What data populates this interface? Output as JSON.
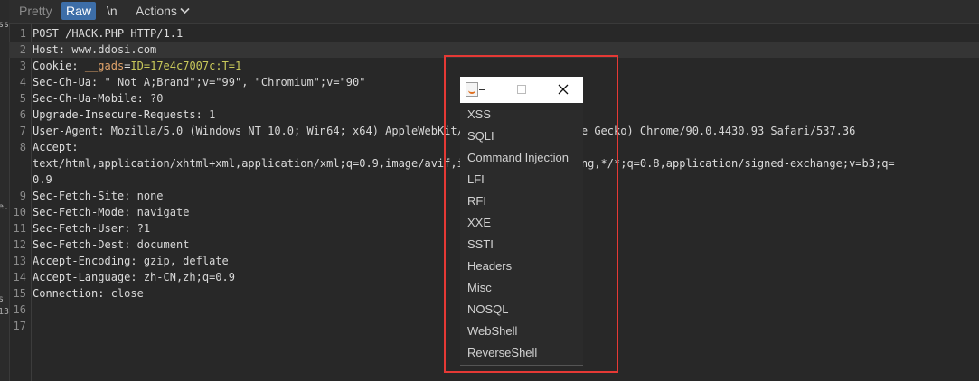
{
  "left_strip": [
    "ss",
    "e..",
    "s",
    "13"
  ],
  "toolbar": {
    "pretty": "Pretty",
    "raw": "Raw",
    "newline": "\\n",
    "actions": "Actions"
  },
  "request": {
    "lines": [
      {
        "no": "1",
        "text": "POST /HACK.PHP HTTP/1.1"
      },
      {
        "no": "2",
        "key": "Host",
        "value": " www.ddosi.com"
      },
      {
        "no": "3",
        "key": "Cookie",
        "value": " ",
        "cookie_name": "__gads",
        "cookie_value": "ID=17e4c7007c:T=1"
      },
      {
        "no": "4",
        "key": "Sec-Ch-Ua",
        "value": " \" Not A;Brand\";v=\"99\", \"Chromium\";v=\"90\""
      },
      {
        "no": "5",
        "key": "Sec-Ch-Ua-Mobile",
        "value": " ?0"
      },
      {
        "no": "6",
        "key": "Upgrade-Insecure-Requests",
        "value": " 1"
      },
      {
        "no": "7",
        "key": "User-Agent",
        "value": " Mozilla/5.0 (Windows NT 10.0; Win64; x64) AppleWebKit/537.36 (KHTML, like Gecko) Chrome/90.0.4430.93 Safari/537.36"
      },
      {
        "no": "8",
        "key": "Accept",
        "value": ""
      },
      {
        "no": "",
        "text": "text/html,application/xhtml+xml,application/xml;q=0.9,image/avif,image/webp,image/apng,*/*;q=0.8,application/signed-exchange;v=b3;q="
      },
      {
        "no": "",
        "text": "0.9"
      },
      {
        "no": "9",
        "key": "Sec-Fetch-Site",
        "value": " none"
      },
      {
        "no": "10",
        "key": "Sec-Fetch-Mode",
        "value": " navigate"
      },
      {
        "no": "11",
        "key": "Sec-Fetch-User",
        "value": " ?1"
      },
      {
        "no": "12",
        "key": "Sec-Fetch-Dest",
        "value": " document"
      },
      {
        "no": "13",
        "key": "Accept-Encoding",
        "value": " gzip, deflate"
      },
      {
        "no": "14",
        "key": "Accept-Language",
        "value": " zh-CN,zh;q=0.9"
      },
      {
        "no": "15",
        "key": "Connection",
        "value": " close"
      },
      {
        "no": "16",
        "text": ""
      },
      {
        "no": "17",
        "text": ""
      }
    ]
  },
  "popup": {
    "items": [
      "XSS",
      "SQLI",
      "Command Injection",
      "LFI",
      "RFI",
      "XXE",
      "SSTI",
      "Headers",
      "Misc",
      "NOSQL",
      "WebShell",
      "ReverseShell"
    ]
  },
  "colors": {
    "raw_active": "#3d6ea8",
    "highlight_box": "#e53935",
    "cookie_value": "#c9c95a"
  }
}
